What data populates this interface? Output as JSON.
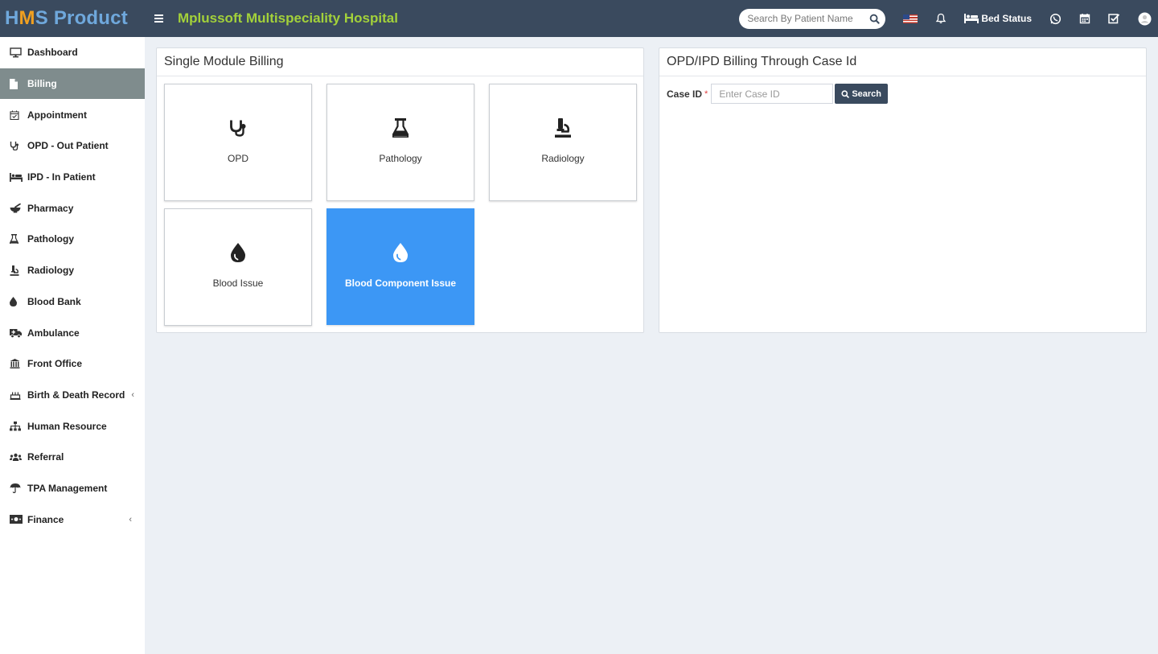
{
  "header": {
    "logo_first": "H",
    "logo_mid": "M",
    "logo_rest": "S Product",
    "hospital_name": "Mplussoft Multispeciality Hospital",
    "search_placeholder": "Search By Patient Name",
    "bed_status_label": "Bed Status",
    "colors": {
      "bar": "#3a4a5e",
      "hospital_name": "#a3d13a",
      "logo": "#6fa8dc",
      "logo_accent": "#f0a020"
    }
  },
  "sidebar": {
    "items": [
      {
        "label": "Dashboard",
        "icon": "monitor-icon"
      },
      {
        "label": "Billing",
        "icon": "file-icon",
        "active": true
      },
      {
        "label": "Appointment",
        "icon": "calendar-check-icon"
      },
      {
        "label": "OPD - Out Patient",
        "icon": "stethoscope-icon"
      },
      {
        "label": "IPD - In Patient",
        "icon": "bed-icon"
      },
      {
        "label": "Pharmacy",
        "icon": "mortar-pestle-icon"
      },
      {
        "label": "Pathology",
        "icon": "flask-icon"
      },
      {
        "label": "Radiology",
        "icon": "microscope-icon"
      },
      {
        "label": "Blood Bank",
        "icon": "tint-icon"
      },
      {
        "label": "Ambulance",
        "icon": "ambulance-icon"
      },
      {
        "label": "Front Office",
        "icon": "building-icon"
      },
      {
        "label": "Birth & Death Record",
        "icon": "cake-icon",
        "chevron": "‹"
      },
      {
        "label": "Human Resource",
        "icon": "sitemap-icon"
      },
      {
        "label": "Referral",
        "icon": "users-icon"
      },
      {
        "label": "TPA Management",
        "icon": "umbrella-icon"
      },
      {
        "label": "Finance",
        "icon": "money-icon",
        "chevron": "‹"
      }
    ]
  },
  "single_module": {
    "title": "Single Module Billing",
    "tiles": [
      {
        "label": "OPD",
        "icon": "stethoscope-icon"
      },
      {
        "label": "Pathology",
        "icon": "flask-icon"
      },
      {
        "label": "Radiology",
        "icon": "microscope-icon"
      },
      {
        "label": "Blood Issue",
        "icon": "tint-icon"
      },
      {
        "label": "Blood Component Issue",
        "icon": "tint-icon",
        "highlighted": true
      }
    ]
  },
  "case_billing": {
    "title": "OPD/IPD Billing Through Case Id",
    "case_label": "Case ID",
    "required_mark": "*",
    "input_placeholder": "Enter Case ID",
    "search_label": "Search"
  }
}
